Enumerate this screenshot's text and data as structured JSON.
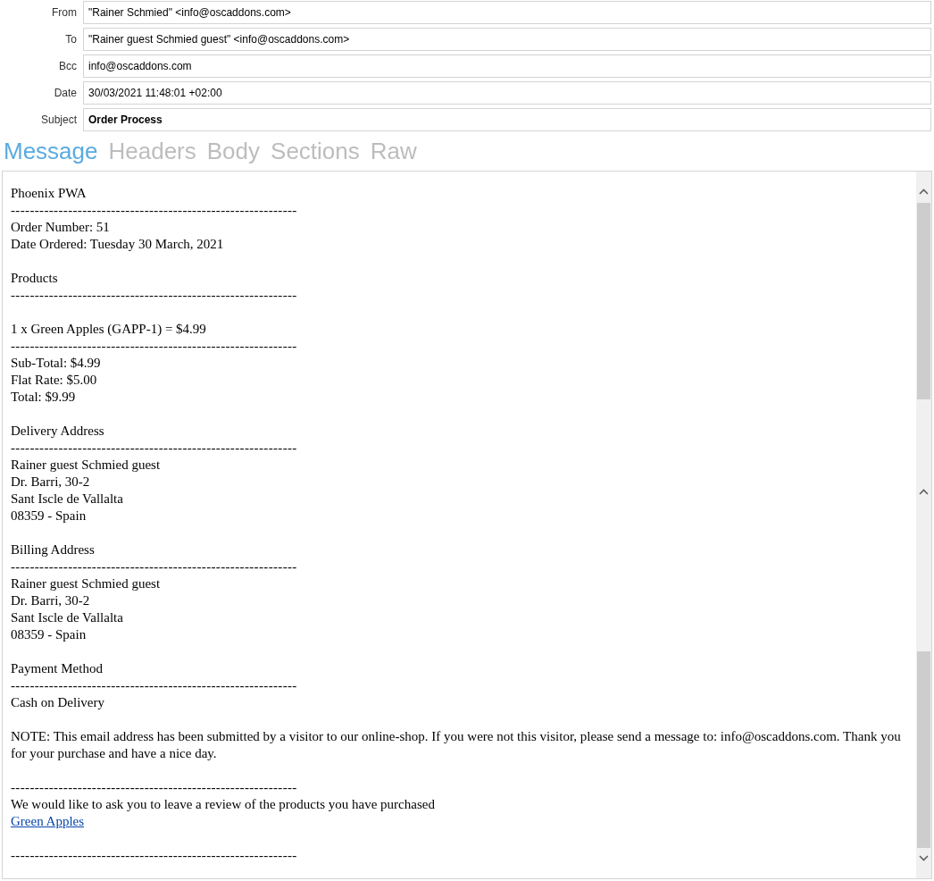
{
  "headers": [
    {
      "label": "From",
      "value": "\"Rainer Schmied\" <info@oscaddons.com>",
      "bold": false
    },
    {
      "label": "To",
      "value": "\"Rainer guest Schmied guest\" <info@oscaddons.com>",
      "bold": false
    },
    {
      "label": "Bcc",
      "value": "info@oscaddons.com",
      "bold": false
    },
    {
      "label": "Date",
      "value": "30/03/2021 11:48:01 +02:00",
      "bold": false
    },
    {
      "label": "Subject",
      "value": "Order Process",
      "bold": true
    }
  ],
  "tabs": [
    {
      "label": "Message",
      "selected": true
    },
    {
      "label": "Headers",
      "selected": false
    },
    {
      "label": "Body",
      "selected": false
    },
    {
      "label": "Sections",
      "selected": false
    },
    {
      "label": "Raw",
      "selected": false
    }
  ],
  "body": [
    {
      "kind": "text",
      "text": "Phoenix PWA"
    },
    {
      "kind": "rule",
      "text": "------------------------------------------------------------"
    },
    {
      "kind": "text",
      "text": "Order Number: 51"
    },
    {
      "kind": "text",
      "text": "Date Ordered: Tuesday 30 March, 2021"
    },
    {
      "kind": "blank"
    },
    {
      "kind": "text",
      "text": "Products"
    },
    {
      "kind": "rule",
      "text": "------------------------------------------------------------"
    },
    {
      "kind": "blank"
    },
    {
      "kind": "text",
      "text": "1 x Green Apples (GAPP-1) = $4.99"
    },
    {
      "kind": "rule",
      "text": "------------------------------------------------------------"
    },
    {
      "kind": "text",
      "text": "Sub-Total: $4.99"
    },
    {
      "kind": "text",
      "text": "Flat Rate: $5.00"
    },
    {
      "kind": "text",
      "text": "Total: $9.99"
    },
    {
      "kind": "blank"
    },
    {
      "kind": "text",
      "text": "Delivery Address"
    },
    {
      "kind": "rule",
      "text": "------------------------------------------------------------"
    },
    {
      "kind": "text",
      "text": "Rainer guest Schmied guest"
    },
    {
      "kind": "text",
      "text": "Dr. Barri, 30-2"
    },
    {
      "kind": "text",
      "text": "Sant Iscle de Vallalta"
    },
    {
      "kind": "text",
      "text": "08359 - Spain"
    },
    {
      "kind": "blank"
    },
    {
      "kind": "text",
      "text": "Billing Address"
    },
    {
      "kind": "rule",
      "text": "------------------------------------------------------------"
    },
    {
      "kind": "text",
      "text": "Rainer guest Schmied guest"
    },
    {
      "kind": "text",
      "text": "Dr. Barri, 30-2"
    },
    {
      "kind": "text",
      "text": "Sant Iscle de Vallalta"
    },
    {
      "kind": "text",
      "text": "08359 - Spain"
    },
    {
      "kind": "blank"
    },
    {
      "kind": "text",
      "text": "Payment Method"
    },
    {
      "kind": "rule",
      "text": "------------------------------------------------------------"
    },
    {
      "kind": "text",
      "text": "Cash on Delivery"
    },
    {
      "kind": "blank"
    },
    {
      "kind": "text",
      "text": "NOTE: This email address has been submitted by a visitor to our online-shop. If you were not this visitor, please send a message to: info@oscaddons.com. Thank you for your purchase and have a nice day."
    },
    {
      "kind": "blank"
    },
    {
      "kind": "rule",
      "text": "------------------------------------------------------------"
    },
    {
      "kind": "text",
      "text": "We would like to ask you to leave a review of the products you have purchased"
    },
    {
      "kind": "link",
      "text": "Green Apples"
    },
    {
      "kind": "blank"
    },
    {
      "kind": "rule",
      "text": "------------------------------------------------------------"
    }
  ]
}
